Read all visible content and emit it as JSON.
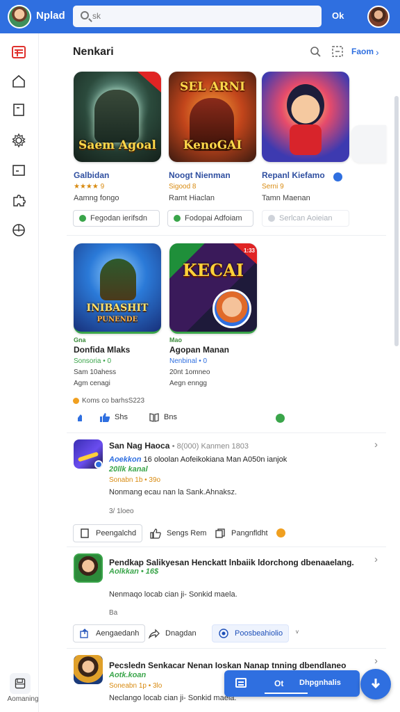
{
  "topbar": {
    "app_name": "Nplad",
    "search_placeholder": "sk",
    "ok_label": "Ok"
  },
  "rail": {
    "bottom_label": "Aomaning"
  },
  "section": {
    "title": "Nenkari",
    "link_label": "Faom"
  },
  "apps_row1": [
    {
      "thumb_text": "Saem Agoal",
      "name": "Galbidan",
      "rating": "★★★★ 9",
      "sub": "Aamng fongo",
      "action": "Fegodan ierifsdn",
      "action_enabled": true
    },
    {
      "thumb_text": "KenoGAI",
      "thumb_top": "SEL ARNI",
      "name": "Noogt Nienman",
      "rating": "Sigood 8",
      "sub": "Ramt Hiaclan",
      "action": "Fodopai Adfoiam",
      "action_enabled": true
    },
    {
      "thumb_text": "",
      "name": "Repanl Kiefamo",
      "rating": "Serni 9",
      "sub": "Tamn Maenan",
      "action": "Serlcan Aoieian",
      "action_enabled": false
    }
  ],
  "apps_row2": [
    {
      "thumb_text": "INIBASHIT",
      "thumb_sub": "PUNENDE",
      "tag": "Gna",
      "name": "Donfida Mlaks",
      "sub1": "Sonsoria • 0",
      "sub2": "Sam 10ahess",
      "sub3": "Agm cenagi"
    },
    {
      "thumb_text": "KECAI",
      "badge": "1:33",
      "tag": "Mao",
      "name": "Agopan Manan",
      "sub1": "Nenbinal • 0",
      "sub2": "20nt 1omneo",
      "sub3": "Aegn enngg"
    }
  ],
  "reactions": {
    "meta": "Koms co barhsS223",
    "like_label": "Shs",
    "share_label": "Bns"
  },
  "posts": [
    {
      "title": "San Nag Haoca",
      "meta": "• 8(000) Kanmen 1803",
      "line2_accent": "Aoekkon",
      "line2": "16 oloolan Aofeikokiana Man A050n ianjok",
      "green": "20llk kanal",
      "small": "Sonabn 1b • 39o",
      "body": "Nonmang ecau nan la Sank.Ahnaksz.",
      "count": "3/ 1loeo",
      "actions": [
        "Peengalchd",
        "Sengs Rem",
        "Pangnfldht"
      ]
    },
    {
      "title": "Pendkap Salikyesan Henckatt lnbaiik ldorchong dbenaaelang.",
      "green": "Aolkkan • 16$",
      "body": "Nenmaqo locab cian ji- Sonkid maela.",
      "count": "Ba",
      "actions": [
        "Aengaedanh",
        "Dnagdan",
        "Poosbeahiolio"
      ]
    },
    {
      "title": "Pecsledn Senkacar Nenan Ioskan Nanap tnning dbendlaneo",
      "green": "Aotk.koan",
      "small": "Soneabn 1p • 3lo",
      "body": "Neclango locab cian ji- Sonkid maela."
    }
  ],
  "floatbar": {
    "ok_label": "Ot",
    "text_label": "Dhpgnhalis"
  }
}
